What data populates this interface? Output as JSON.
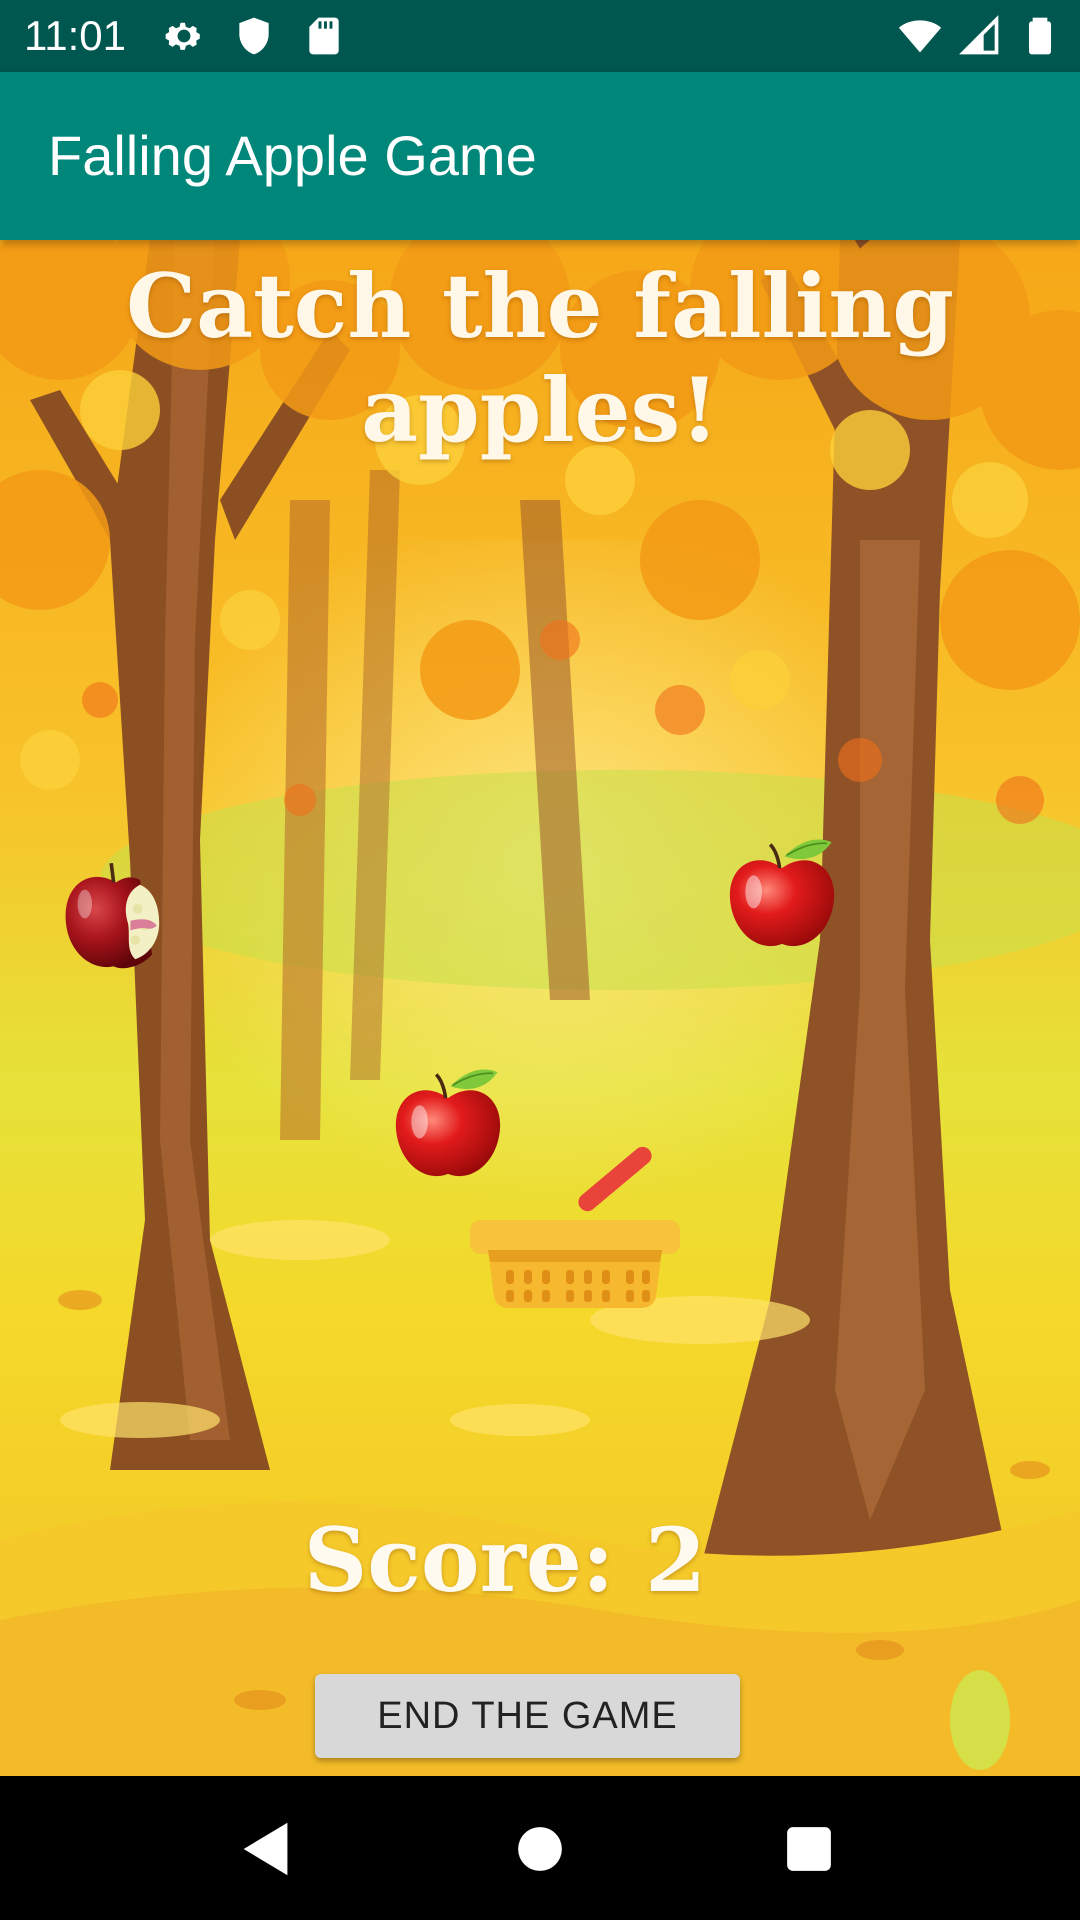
{
  "status_bar": {
    "time": "11:01",
    "left_icons": [
      "gear-icon",
      "shield-icon",
      "sd-card-icon"
    ],
    "right_icons": [
      "wifi-icon",
      "signal-icon",
      "battery-icon"
    ]
  },
  "app_bar": {
    "title": "Falling Apple Game"
  },
  "game": {
    "headline": "Catch the falling apples!",
    "score_text": "Score: 2",
    "end_button_label": "END THE GAME",
    "sprites": [
      "wormy-apple",
      "red-apple",
      "red-apple",
      "basket"
    ]
  },
  "nav_bar": {
    "buttons": [
      "back-icon",
      "home-icon",
      "recents-icon"
    ]
  },
  "colors": {
    "status_bar": "#00574f",
    "app_bar": "#00877a",
    "button": "#d8d8d8"
  }
}
